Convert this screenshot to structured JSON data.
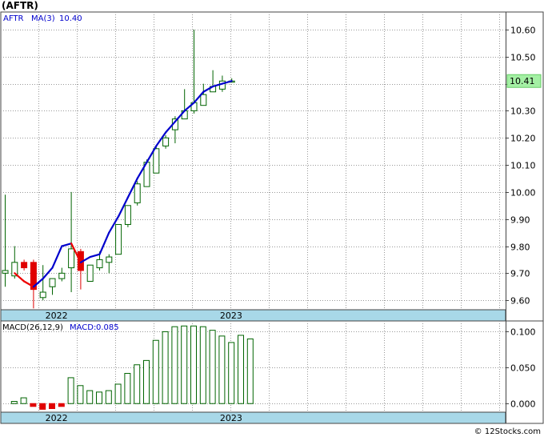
{
  "ticker_title": "(AFTR)",
  "footer": "© 12Stocks.com",
  "colors": {
    "up": "#006400",
    "down": "#e00000",
    "ma_up": "#0000cc",
    "ma_down": "#ee0000",
    "grid": "#999999",
    "axis_band": "#a8d8e8",
    "last_price_box": "#a4f0a4",
    "text_blue": "#0000cc"
  },
  "chart_data": [
    {
      "type": "candlestick",
      "title": "AFTR",
      "legend": [
        {
          "label": "AFTR",
          "value": ""
        },
        {
          "label": "MA(3)",
          "value": "10.40"
        }
      ],
      "y_ticks": [
        "9.60",
        "9.70",
        "9.80",
        "9.90",
        "10.00",
        "10.10",
        "10.20",
        "10.30",
        "10.40",
        "10.50",
        "10.60"
      ],
      "ylim": [
        9.565,
        10.665
      ],
      "last_price": "10.41",
      "x_labels": [
        {
          "label": "2022",
          "index": 4.5
        },
        {
          "label": "2023",
          "index": 23
        }
      ],
      "candles": [
        {
          "o": 9.7,
          "h": 9.99,
          "l": 9.65,
          "c": 9.71
        },
        {
          "o": 9.69,
          "h": 9.8,
          "l": 9.68,
          "c": 9.74
        },
        {
          "o": 9.74,
          "h": 9.75,
          "l": 9.71,
          "c": 9.72
        },
        {
          "o": 9.74,
          "h": 9.75,
          "l": 9.57,
          "c": 9.64
        },
        {
          "o": 9.61,
          "h": 9.73,
          "l": 9.6,
          "c": 9.63
        },
        {
          "o": 9.65,
          "h": 9.68,
          "l": 9.62,
          "c": 9.68
        },
        {
          "o": 9.68,
          "h": 9.72,
          "l": 9.67,
          "c": 9.7
        },
        {
          "o": 9.72,
          "h": 10.0,
          "l": 9.63,
          "c": 9.79
        },
        {
          "o": 9.78,
          "h": 9.79,
          "l": 9.64,
          "c": 9.71
        },
        {
          "o": 9.67,
          "h": 9.73,
          "l": 9.67,
          "c": 9.73
        },
        {
          "o": 9.72,
          "h": 9.78,
          "l": 9.71,
          "c": 9.75
        },
        {
          "o": 9.74,
          "h": 9.77,
          "l": 9.7,
          "c": 9.76
        },
        {
          "o": 9.77,
          "h": 9.88,
          "l": 9.77,
          "c": 9.88
        },
        {
          "o": 9.88,
          "h": 9.95,
          "l": 9.87,
          "c": 9.95
        },
        {
          "o": 9.96,
          "h": 10.04,
          "l": 9.95,
          "c": 10.03
        },
        {
          "o": 10.02,
          "h": 10.12,
          "l": 10.02,
          "c": 10.11
        },
        {
          "o": 10.07,
          "h": 10.17,
          "l": 10.07,
          "c": 10.16
        },
        {
          "o": 10.17,
          "h": 10.21,
          "l": 10.16,
          "c": 10.2
        },
        {
          "o": 10.23,
          "h": 10.28,
          "l": 10.18,
          "c": 10.27
        },
        {
          "o": 10.27,
          "h": 10.38,
          "l": 10.27,
          "c": 10.3
        },
        {
          "o": 10.3,
          "h": 10.6,
          "l": 10.29,
          "c": 10.33
        },
        {
          "o": 10.32,
          "h": 10.4,
          "l": 10.32,
          "c": 10.36
        },
        {
          "o": 10.37,
          "h": 10.45,
          "l": 10.37,
          "c": 10.39
        },
        {
          "o": 10.38,
          "h": 10.43,
          "l": 10.37,
          "c": 10.41
        },
        {
          "o": 10.41,
          "h": 10.42,
          "l": 10.41,
          "c": 10.41
        }
      ],
      "ma3": [
        null,
        9.7,
        9.67,
        9.65,
        9.68,
        9.72,
        9.8,
        9.81,
        9.74,
        9.76,
        9.77,
        9.85,
        9.91,
        9.98,
        10.05,
        10.11,
        10.17,
        10.22,
        10.26,
        10.3,
        10.33,
        10.37,
        10.39,
        10.4,
        10.41
      ]
    },
    {
      "type": "bar",
      "title": "MACD(26,12,9)",
      "legend": [
        {
          "label": "MACD(26,12,9)",
          "value": ""
        },
        {
          "label": "MACD:",
          "value": "0.085"
        }
      ],
      "y_ticks": [
        "0.000",
        "0.050",
        "0.100"
      ],
      "ylim": [
        -0.012,
        0.115
      ],
      "x_labels": [
        {
          "label": "2022",
          "index": 4.5
        },
        {
          "label": "2023",
          "index": 23
        }
      ],
      "values": [
        0.003,
        0.008,
        -0.004,
        -0.008,
        -0.007,
        -0.004,
        0.036,
        0.025,
        0.018,
        0.016,
        0.018,
        0.027,
        0.042,
        0.054,
        0.06,
        0.088,
        0.1,
        0.107,
        0.108,
        0.108,
        0.107,
        0.102,
        0.094,
        0.085,
        0.095,
        0.09
      ]
    }
  ]
}
